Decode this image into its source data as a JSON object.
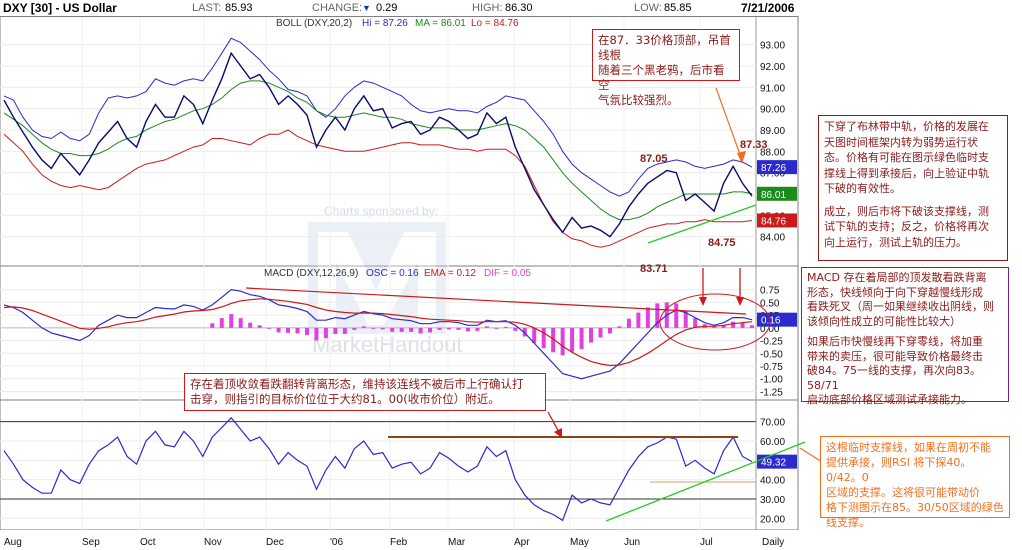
{
  "header": {
    "symbol": "DXY [30] - US Dollar",
    "last_label": "LAST:",
    "last_value": "85.93",
    "change_label": "CHANGE:",
    "change_arrow": "▼",
    "change_value": "0.29",
    "high_label": "HIGH:",
    "high_value": "86.30",
    "low_label": "LOW:",
    "low_value": "85.85",
    "date": "7/21/2006"
  },
  "boll_legend": {
    "name": "BOLL (DXY,20,2)",
    "hi": "Hi = 87.26",
    "ma": "MA = 86.01",
    "lo": "Lo = 84.76"
  },
  "macd_legend": {
    "name": "MACD (DXY,12,26,9)",
    "osc": "OSC = 0.16",
    "ema": "EMA = 0.12",
    "dif": "DIF = 0.05"
  },
  "sponsor": {
    "line": "Charts sponsored by:",
    "brand": "MarketHandout"
  },
  "annotations": {
    "top_box": [
      "在87．33价格顶部，吊首线根",
      "随着三个黑老鸦，后市看空",
      "气氛比较强烈。"
    ],
    "right_box1": [
      "下穿了布林带中轨，价格的发展在",
      "天图时间框架内转为弱势运行状",
      "态。价格有可能在图示绿色临时支",
      "撑线上得到承接后，向上验证中轨",
      "下破的有效性。",
      "",
      "成立，则后市将下破该支撑线，测",
      "试下轨的支持；反之，价格将再次",
      "向上运行，测试上轨的压力。"
    ],
    "right_box2": [
      "MACD 存在着局部的顶发散看跌背离",
      "形态，快线倾向于向下穿越慢线形成",
      "看跌死叉（周一如果继续收出阴线，则",
      "该倾向性成立的可能性比较大）",
      "",
      "如果后市快慢线再下穿零线，将加重",
      "带来的卖压，很可能导致价格最终击",
      "破84。75一线的支撑，再次向83。58/71",
      "启动底部价格区域测试承接能力。"
    ],
    "middle_box": [
      "存在着顶收敛看跌翻转背离形态，维持该连线不被后市上行确认打",
      "击穿，则指引的目标价位位于大约81。00(收市价位）附近。"
    ],
    "orange_box": [
      "这根临时支撑线，如果在周初不能",
      "提供承接，则RSI 将下探40。0/42。0",
      "区域的支撑。这将很可能带动价",
      "格下测图示在85。30/50区域的绿色",
      "线支撑。"
    ]
  },
  "price_marks": {
    "p1": "87.05",
    "p2": "87.33",
    "p3": "84.75",
    "p4": "83.71"
  },
  "colors": {
    "boll_upper": "#2b2bcc",
    "boll_mid": "#1c8a1c",
    "boll_lower": "#cc1a1a",
    "price": "#0a0a6e",
    "macd_line": "#2b2bcc",
    "ema_line": "#cc1a1a",
    "hist": "#e040e0",
    "rsi": "#2b2bcc",
    "annot_red": "#cc1a1a",
    "annot_dark": "#8b1a1a",
    "annot_purple": "#7b1fa2",
    "annot_orange": "#f07020",
    "trend_green": "#22cc22",
    "resist_brown": "#8b4513"
  },
  "chart_data": [
    {
      "type": "line",
      "title": "DXY [30] - US Dollar",
      "ylim": [
        83.0,
        93.5
      ],
      "yticks": [
        "93.00",
        "92.00",
        "91.00",
        "90.00",
        "89.00",
        "88.00",
        "87.00",
        "86.00",
        "85.00",
        "84.00"
      ],
      "x_ticks": [
        "Aug",
        "Sep",
        "Oct",
        "Nov",
        "Dec",
        "'06",
        "Feb",
        "Mar",
        "Apr",
        "May",
        "Jun",
        "Jul",
        "Daily"
      ],
      "price_close": [
        90.4,
        89.6,
        88.9,
        88.2,
        87.6,
        87.2,
        87.9,
        87.4,
        86.9,
        87.6,
        88.4,
        88.9,
        89.4,
        88.6,
        88.2,
        89.4,
        90.2,
        89.6,
        89.6,
        90.6,
        90.2,
        89.3,
        90.4,
        91.4,
        92.6,
        92.0,
        91.4,
        91.6,
        91.0,
        90.2,
        90.6,
        90.2,
        89.7,
        88.2,
        89.0,
        89.6,
        89.0,
        90.0,
        90.6,
        89.9,
        90.0,
        89.1,
        89.3,
        89.4,
        88.8,
        89.0,
        89.6,
        89.4,
        89.0,
        88.6,
        88.8,
        89.8,
        89.3,
        89.6,
        88.2,
        87.2,
        86.2,
        85.5,
        84.8,
        84.2,
        84.9,
        84.4,
        84.5,
        84.3,
        84.0,
        84.6,
        85.4,
        86.0,
        86.5,
        86.8,
        87.1,
        87.0,
        85.7,
        86.0,
        85.6,
        85.2,
        86.5,
        87.3,
        86.5,
        85.9
      ],
      "series": [
        {
          "name": "Hi",
          "values": [
            90.6,
            90.4,
            89.6,
            89.0,
            88.7,
            88.6,
            88.9,
            88.6,
            88.5,
            88.8,
            89.8,
            90.5,
            90.6,
            90.5,
            90.6,
            90.8,
            91.4,
            91.2,
            91.1,
            91.3,
            91.4,
            91.3,
            91.9,
            92.6,
            93.3,
            93.1,
            92.7,
            92.3,
            91.8,
            91.4,
            90.9,
            90.8,
            90.6,
            89.9,
            89.6,
            90.0,
            90.6,
            91.0,
            91.3,
            91.2,
            91.0,
            90.8,
            90.6,
            90.2,
            89.9,
            89.8,
            89.9,
            90.0,
            89.9,
            89.9,
            89.8,
            90.1,
            90.3,
            90.6,
            90.5,
            90.4,
            89.9,
            89.4,
            88.8,
            88.0,
            87.4,
            87.0,
            86.7,
            86.4,
            86.1,
            85.9,
            86.1,
            86.7,
            87.2,
            87.4,
            87.5,
            87.6,
            87.5,
            87.3,
            87.2,
            87.3,
            87.4,
            87.6,
            87.5,
            87.26
          ]
        },
        {
          "name": "MA",
          "values": [
            89.8,
            89.5,
            89.2,
            88.8,
            88.4,
            88.1,
            87.9,
            87.9,
            87.8,
            87.8,
            87.9,
            88.1,
            88.4,
            88.6,
            88.7,
            89.0,
            89.2,
            89.4,
            89.5,
            89.7,
            89.9,
            90.0,
            90.2,
            90.5,
            90.9,
            91.2,
            91.3,
            91.3,
            91.2,
            91.0,
            90.8,
            90.5,
            90.3,
            89.9,
            89.7,
            89.6,
            89.6,
            89.7,
            89.8,
            89.7,
            89.6,
            89.6,
            89.5,
            89.3,
            89.2,
            89.1,
            89.1,
            89.1,
            89.0,
            89.0,
            89.0,
            89.1,
            89.2,
            89.3,
            89.2,
            89.0,
            88.6,
            88.2,
            87.6,
            87.0,
            86.5,
            86.1,
            85.7,
            85.3,
            85.0,
            84.8,
            84.8,
            84.9,
            85.1,
            85.4,
            85.6,
            85.8,
            86.0,
            86.0,
            86.0,
            86.0,
            86.0,
            86.1,
            86.1,
            86.01
          ]
        },
        {
          "name": "Lo",
          "values": [
            88.8,
            88.4,
            88.0,
            87.4,
            86.9,
            86.6,
            86.4,
            86.3,
            86.4,
            86.3,
            86.2,
            86.3,
            86.6,
            86.9,
            87.2,
            87.4,
            87.5,
            87.6,
            87.8,
            88.0,
            88.2,
            88.3,
            88.6,
            88.6,
            88.5,
            88.4,
            88.3,
            88.6,
            88.8,
            88.8,
            89.0,
            88.7,
            88.5,
            88.3,
            88.2,
            88.1,
            88.0,
            88.0,
            88.0,
            88.1,
            88.2,
            88.3,
            88.4,
            88.4,
            88.3,
            88.3,
            88.3,
            88.2,
            88.1,
            88.1,
            88.0,
            88.1,
            88.1,
            88.1,
            87.8,
            87.3,
            86.4,
            85.5,
            84.7,
            84.2,
            83.9,
            83.8,
            83.6,
            83.5,
            83.6,
            83.8,
            84.0,
            84.2,
            84.4,
            84.5,
            84.6,
            84.6,
            84.7,
            84.7,
            84.8,
            84.7,
            84.7,
            84.7,
            84.7,
            84.76
          ]
        }
      ],
      "value_tags": [
        "87.26",
        "86.01",
        "84.76"
      ]
    },
    {
      "type": "line",
      "title": "MACD (DXY,12,26,9)",
      "ylim": [
        -1.3,
        0.9
      ],
      "yticks": [
        "0.75",
        "0.50",
        "0.25",
        "0.00",
        "-0.25",
        "-0.50",
        "-0.75",
        "-1.00",
        "-1.25"
      ],
      "series": [
        {
          "name": "OSC",
          "values": [
            0.45,
            0.4,
            0.3,
            0.15,
            0.0,
            -0.1,
            -0.15,
            -0.2,
            -0.25,
            -0.15,
            0.05,
            0.15,
            0.25,
            0.2,
            0.2,
            0.3,
            0.4,
            0.38,
            0.37,
            0.45,
            0.42,
            0.35,
            0.45,
            0.6,
            0.75,
            0.72,
            0.65,
            0.62,
            0.55,
            0.45,
            0.42,
            0.38,
            0.32,
            0.15,
            0.15,
            0.2,
            0.18,
            0.25,
            0.32,
            0.28,
            0.25,
            0.18,
            0.16,
            0.14,
            0.08,
            0.08,
            0.12,
            0.12,
            0.1,
            0.05,
            0.05,
            0.15,
            0.12,
            0.14,
            0.05,
            -0.1,
            -0.3,
            -0.5,
            -0.7,
            -0.9,
            -0.95,
            -1.0,
            -0.95,
            -0.9,
            -0.85,
            -0.7,
            -0.5,
            -0.3,
            -0.1,
            0.1,
            0.25,
            0.35,
            0.3,
            0.2,
            0.1,
            0.05,
            0.1,
            0.2,
            0.2,
            0.16
          ]
        },
        {
          "name": "EMA",
          "values": [
            0.4,
            0.41,
            0.39,
            0.34,
            0.27,
            0.2,
            0.13,
            0.06,
            -0.01,
            -0.03,
            -0.01,
            0.02,
            0.07,
            0.1,
            0.12,
            0.16,
            0.21,
            0.24,
            0.27,
            0.31,
            0.33,
            0.34,
            0.36,
            0.41,
            0.48,
            0.53,
            0.55,
            0.57,
            0.56,
            0.54,
            0.52,
            0.49,
            0.46,
            0.4,
            0.35,
            0.32,
            0.3,
            0.29,
            0.29,
            0.29,
            0.28,
            0.26,
            0.24,
            0.22,
            0.19,
            0.17,
            0.16,
            0.15,
            0.14,
            0.12,
            0.11,
            0.12,
            0.12,
            0.12,
            0.11,
            0.07,
            0.0,
            -0.1,
            -0.22,
            -0.36,
            -0.48,
            -0.58,
            -0.66,
            -0.71,
            -0.74,
            -0.73,
            -0.68,
            -0.6,
            -0.5,
            -0.38,
            -0.25,
            -0.13,
            -0.04,
            0.01,
            0.03,
            0.03,
            0.05,
            0.08,
            0.1,
            0.12
          ]
        },
        {
          "name": "DIF",
          "values": [
            0.05,
            -0.01,
            -0.09,
            -0.19,
            -0.27,
            -0.3,
            -0.28,
            -0.26,
            -0.24,
            -0.12,
            0.06,
            0.13,
            0.18,
            0.1,
            0.08,
            0.14,
            0.19,
            0.14,
            0.1,
            0.14,
            0.09,
            0.01,
            0.09,
            0.19,
            0.27,
            0.19,
            0.1,
            0.05,
            -0.01,
            -0.09,
            -0.1,
            -0.11,
            -0.14,
            -0.25,
            -0.2,
            -0.12,
            -0.12,
            -0.04,
            0.03,
            -0.01,
            -0.03,
            -0.08,
            -0.08,
            -0.08,
            -0.11,
            -0.09,
            -0.04,
            -0.03,
            -0.04,
            -0.07,
            -0.06,
            0.03,
            0.0,
            0.02,
            -0.06,
            -0.17,
            -0.3,
            -0.4,
            -0.48,
            -0.54,
            -0.47,
            -0.42,
            -0.29,
            -0.19,
            -0.11,
            0.03,
            0.18,
            0.3,
            0.4,
            0.48,
            0.5,
            0.48,
            0.34,
            0.19,
            0.07,
            0.02,
            0.05,
            0.12,
            0.1,
            0.05
          ]
        }
      ],
      "value_tags": [
        "0.16"
      ]
    },
    {
      "type": "line",
      "title": "RSI",
      "ylim": [
        15,
        75
      ],
      "yticks": [
        "70.00",
        "60.00",
        "50.00",
        "40.00",
        "30.00",
        "20.00"
      ],
      "reference_lines": [
        70,
        30
      ],
      "series": [
        {
          "name": "RSI",
          "values": [
            55,
            48,
            40,
            36,
            33,
            33,
            45,
            40,
            38,
            48,
            55,
            58,
            62,
            52,
            48,
            60,
            65,
            58,
            57,
            65,
            60,
            52,
            62,
            67,
            72,
            66,
            60,
            62,
            56,
            48,
            54,
            50,
            47,
            35,
            45,
            52,
            46,
            56,
            60,
            53,
            54,
            46,
            48,
            49,
            43,
            46,
            54,
            51,
            47,
            44,
            47,
            57,
            52,
            55,
            40,
            32,
            27,
            24,
            22,
            19,
            32,
            28,
            30,
            28,
            27,
            36,
            45,
            52,
            57,
            59,
            62,
            61,
            47,
            50,
            46,
            43,
            55,
            62,
            52,
            49.32
          ]
        }
      ],
      "value_tags": [
        "49.32"
      ]
    }
  ]
}
